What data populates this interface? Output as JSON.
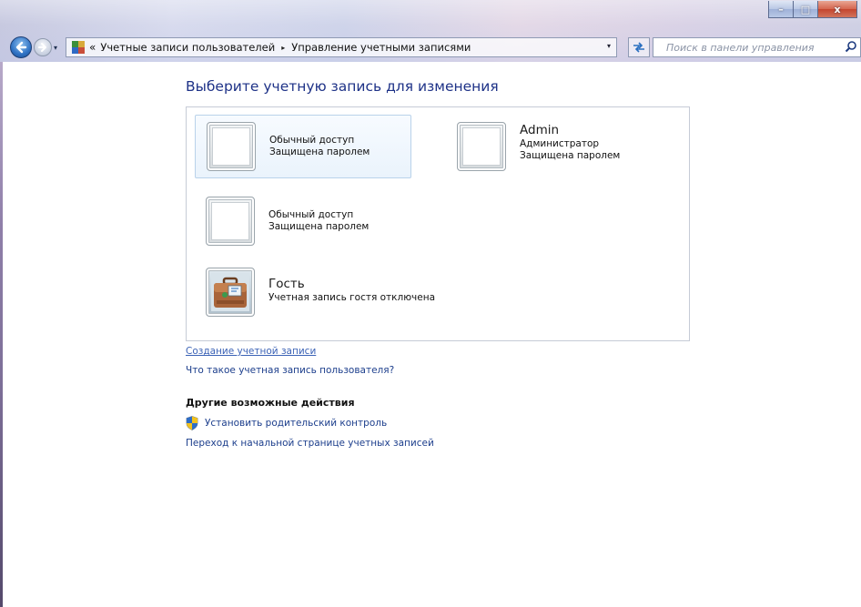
{
  "window": {
    "minimize_glyph": "–",
    "maximize_glyph": "□",
    "close_glyph": "x"
  },
  "nav": {
    "history_dropdown": "▾",
    "address_icon": "control-panel-users-icon",
    "chevrons": "«",
    "breadcrumb": [
      "Учетные записи пользователей",
      "Управление учетными записями"
    ],
    "separator": "▸",
    "address_dropdown": "▾",
    "refresh_glyph": "↹",
    "search_placeholder": "Поиск в панели управления"
  },
  "main": {
    "title": "Выберите учетную запись для изменения",
    "accounts": [
      {
        "name": "",
        "line1": "Обычный доступ",
        "line2": "Защищена паролем",
        "avatar": "blank-avatar",
        "selected": true
      },
      {
        "name": "Admin",
        "line1": "Администратор",
        "line2": "Защищена паролем",
        "avatar": "blank-avatar",
        "selected": false
      },
      {
        "name": "",
        "line1": "Обычный доступ",
        "line2": "Защищена паролем",
        "avatar": "blank-avatar",
        "selected": false
      },
      {
        "name": "Гость",
        "line1": "Учетная запись гостя отключена",
        "line2": "",
        "avatar": "guest-suitcase-avatar",
        "selected": false
      }
    ],
    "create_link": "Создание учетной записи",
    "what_is_link": "Что такое учетная запись пользователя?",
    "other_actions_title": "Другие возможные действия",
    "parental_control_link": "Установить родительский контроль",
    "home_link": "Переход к начальной странице учетных записей"
  },
  "colors": {
    "title": "#1e3287",
    "link": "#1c3e8c",
    "selected_bg": "#eaf3fc",
    "box_border": "#c6cbd6"
  }
}
